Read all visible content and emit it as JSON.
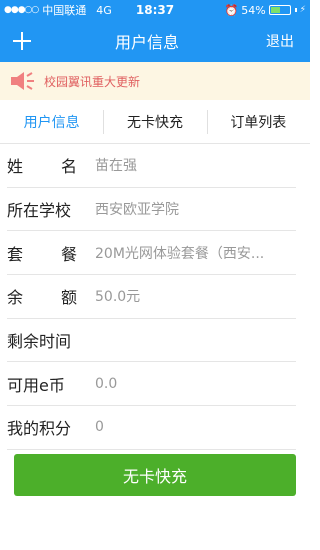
{
  "status_bar": {
    "signal": "●●●○○",
    "carrier": "中国联通",
    "network": "4G",
    "time": "18:37",
    "battery_percent": "54%",
    "battery_level": 0.54
  },
  "nav": {
    "plus_icon": "plus-icon",
    "title": "用户信息",
    "logout_label": "退出"
  },
  "notice": {
    "icon": "speaker-icon",
    "text": "校园翼讯重大更新"
  },
  "tabs": [
    {
      "label": "用户信息",
      "active": true
    },
    {
      "label": "无卡快充",
      "active": false
    },
    {
      "label": "订单列表",
      "active": false
    }
  ],
  "user_info": {
    "name": {
      "label_a": "姓",
      "label_b": "名",
      "value": "苗在强"
    },
    "school": {
      "label": "所在学校",
      "value": "西安欧亚学院"
    },
    "package": {
      "label_a": "套",
      "label_b": "餐",
      "value": "20M光网体验套餐（西安..."
    },
    "balance": {
      "label_a": "余",
      "label_b": "额",
      "value": "50.0元"
    },
    "remaining_time": {
      "label": "剩余时间",
      "value": ""
    },
    "ecoin": {
      "label": "可用e币",
      "value": "0.0"
    },
    "points": {
      "label": "我的积分",
      "value": "0"
    }
  },
  "submit_label": "无卡快充",
  "colors": {
    "primary": "#2196f3",
    "button": "#4caf2a",
    "notice_bg": "#fdf6e3",
    "notice_text": "#e06060"
  }
}
